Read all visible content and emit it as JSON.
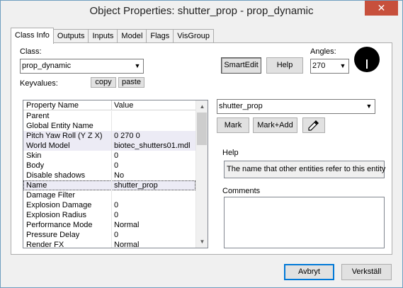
{
  "window": {
    "title": "Object Properties: shutter_prop - prop_dynamic",
    "close_glyph": "✕"
  },
  "tabs": [
    {
      "label": "Class Info",
      "active": true
    },
    {
      "label": "Outputs"
    },
    {
      "label": "Inputs"
    },
    {
      "label": "Model"
    },
    {
      "label": "Flags"
    },
    {
      "label": "VisGroup"
    }
  ],
  "class_info": {
    "class_label": "Class:",
    "class_value": "prop_dynamic",
    "keyvalues_label": "Keyvalues:",
    "copy_label": "copy",
    "paste_label": "paste",
    "smartedit_label": "SmartEdit",
    "help_label": "Help",
    "angles_label": "Angles:",
    "angles_value": "270"
  },
  "grid": {
    "headers": {
      "name": "Property Name",
      "value": "Value"
    },
    "rows": [
      {
        "name": "Parent",
        "value": ""
      },
      {
        "name": "Global Entity Name",
        "value": ""
      },
      {
        "name": "Pitch Yaw Roll (Y Z X)",
        "value": "0 270 0"
      },
      {
        "name": "World Model",
        "value": "biotec_shutters01.mdl"
      },
      {
        "name": "Skin",
        "value": "0"
      },
      {
        "name": "Body",
        "value": "0"
      },
      {
        "name": "Disable shadows",
        "value": "No"
      },
      {
        "name": "Name",
        "value": "shutter_prop"
      },
      {
        "name": "Damage Filter",
        "value": ""
      },
      {
        "name": "Explosion Damage",
        "value": "0"
      },
      {
        "name": "Explosion Radius",
        "value": "0"
      },
      {
        "name": "Performance Mode",
        "value": "Normal"
      },
      {
        "name": "Pressure Delay",
        "value": "0"
      },
      {
        "name": "Render FX",
        "value": "Normal"
      }
    ]
  },
  "value_editor": {
    "value": "shutter_prop",
    "mark_label": "Mark",
    "mark_add_label": "Mark+Add",
    "eyedropper_icon": "eyedropper-icon"
  },
  "help_box": {
    "label": "Help",
    "text": "The name that other entities refer to this entity"
  },
  "comments": {
    "label": "Comments",
    "value": ""
  },
  "footer": {
    "cancel_label": "Avbryt",
    "apply_label": "Verkställ"
  }
}
